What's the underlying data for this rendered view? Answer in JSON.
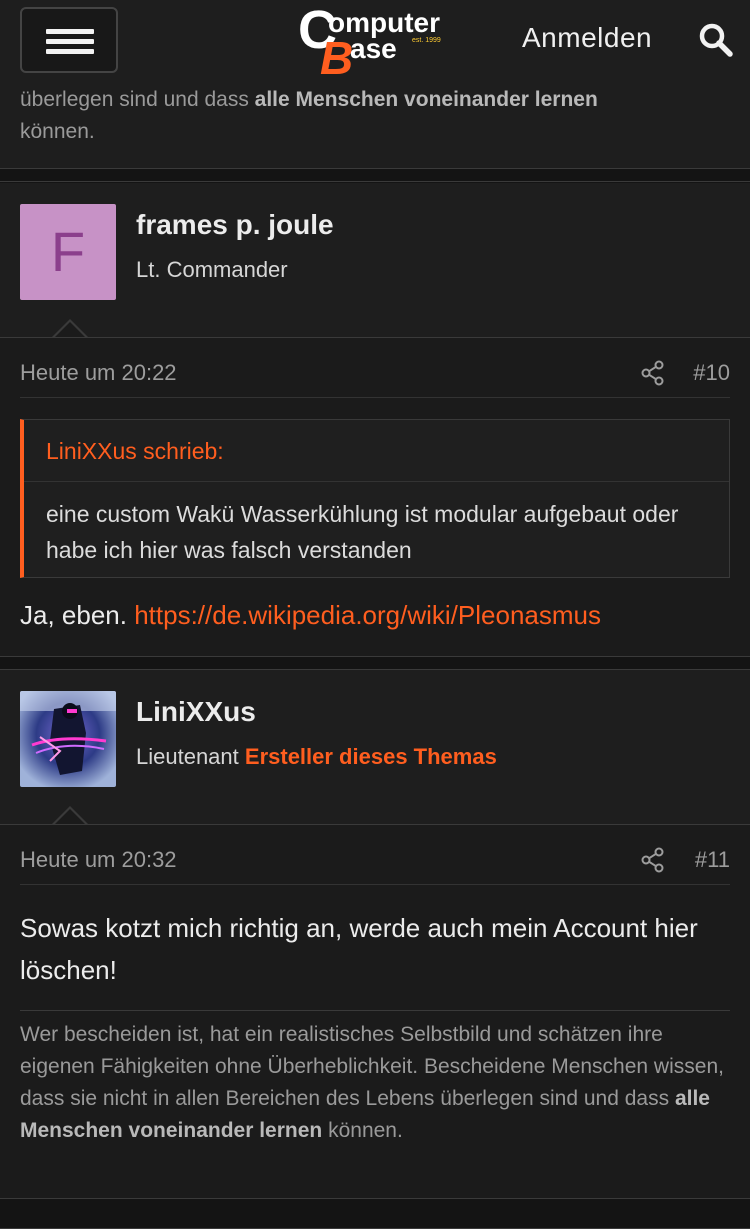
{
  "header": {
    "logo": {
      "line1": "omputer",
      "line2": "ase",
      "big_c": "C",
      "big_b": "B",
      "est": "est. 1999"
    },
    "login_label": "Anmelden"
  },
  "top_signature": {
    "line1_pre": "überlegen sind und dass ",
    "line1_bold": "alle Menschen voneinander lernen",
    "line2": "können."
  },
  "posts": [
    {
      "username": "frames p. joule",
      "avatar_letter": "F",
      "title": "Lt. Commander",
      "date": "Heute um 20:22",
      "number": "#10",
      "quote": {
        "author": "LiniXXus schrieb:",
        "text": "eine custom Wakü Wasserkühlung ist modular aufgebaut oder habe ich hier was falsch verstanden"
      },
      "body_text": "Ja, eben. ",
      "body_link": "https://de.wikipedia.org/wiki/Pleonasmus"
    },
    {
      "username": "LiniXXus",
      "title": "Lieutenant",
      "badge": "Ersteller dieses Themas",
      "date": "Heute um 20:32",
      "number": "#11",
      "body_text": "Sowas kotzt mich richtig an, werde auch mein Account hier löschen!",
      "signature": {
        "pre": "Wer bescheiden ist, hat ein realistisches Selbstbild und schätzen ihre eigenen Fähigkeiten ohne Überheblichkeit. Bescheidene Menschen wissen, dass sie nicht in allen Bereichen des Lebens überlegen sind und dass ",
        "bold": "alle Menschen voneinander lernen",
        "post": " können."
      }
    }
  ],
  "colors": {
    "accent": "#ff5e1f",
    "background": "#141414",
    "panel": "#1e1e1e"
  }
}
